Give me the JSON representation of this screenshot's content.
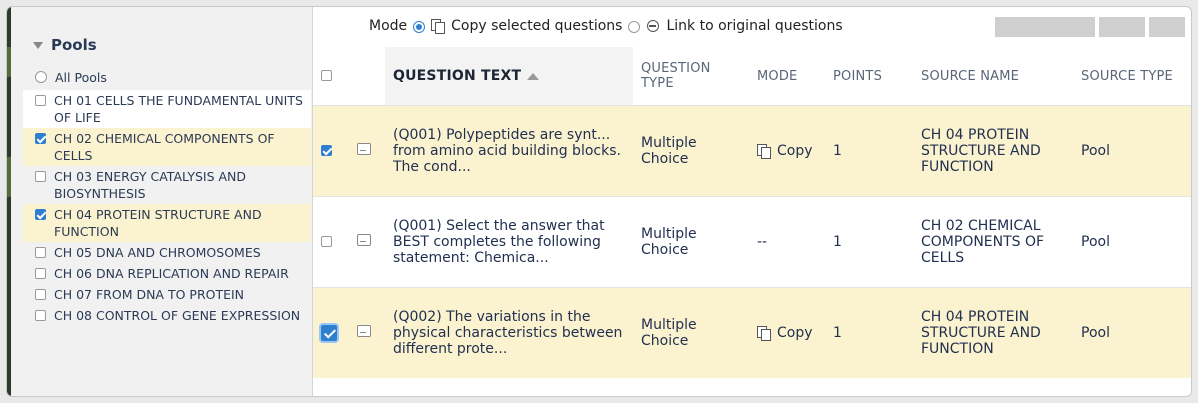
{
  "sidebar": {
    "header": "Pools",
    "all_pools": "All Pools",
    "items": [
      {
        "label": "CH 01 CELLS THE FUNDAMENTAL UNITS OF LIFE",
        "checked": false
      },
      {
        "label": "CH 02 CHEMICAL COMPONENTS OF CELLS",
        "checked": true
      },
      {
        "label": "CH 03 ENERGY CATALYSIS AND BIOSYNTHESIS",
        "checked": false
      },
      {
        "label": "CH 04 PROTEIN STRUCTURE AND FUNCTION",
        "checked": true
      },
      {
        "label": "CH 05 DNA AND CHROMOSOMES",
        "checked": false
      },
      {
        "label": "CH 06 DNA REPLICATION AND REPAIR",
        "checked": false
      },
      {
        "label": "CH 07 FROM DNA TO PROTEIN",
        "checked": false
      },
      {
        "label": "CH 08 CONTROL OF GENE EXPRESSION",
        "checked": false
      }
    ]
  },
  "mode_bar": {
    "label": "Mode",
    "copy_option": "Copy selected questions",
    "link_option": "Link to original questions",
    "selected": "copy"
  },
  "table": {
    "headers": {
      "question_text": "QUESTION TEXT",
      "question_type": "QUESTION TYPE",
      "mode": "MODE",
      "points": "POINTS",
      "source_name": "SOURCE NAME",
      "source_type": "SOURCE TYPE"
    },
    "rows": [
      {
        "selected": true,
        "question": "(Q001) Polypeptides are synt... from amino acid building blocks. The cond...",
        "type": "Multiple Choice",
        "mode": "Copy",
        "points": "1",
        "source_name": "CH 04 PROTEIN STRUCTURE AND FUNCTION",
        "source_type": "Pool"
      },
      {
        "selected": false,
        "question": "(Q001) Select the answer that BEST completes the following statement: Chemica...",
        "type": "Multiple Choice",
        "mode": "--",
        "points": "1",
        "source_name": "CH 02 CHEMICAL COMPONENTS OF CELLS",
        "source_type": "Pool"
      },
      {
        "selected": true,
        "question": "(Q002) The variations in the physical characteristics between different prote...",
        "type": "Multiple Choice",
        "mode": "Copy",
        "points": "1",
        "source_name": "CH 04 PROTEIN STRUCTURE AND FUNCTION",
        "source_type": "Pool"
      }
    ]
  },
  "colors": {
    "selected_row": "#fbf3cf",
    "accent": "#2f7fd1",
    "header_text": "#5a6678"
  }
}
